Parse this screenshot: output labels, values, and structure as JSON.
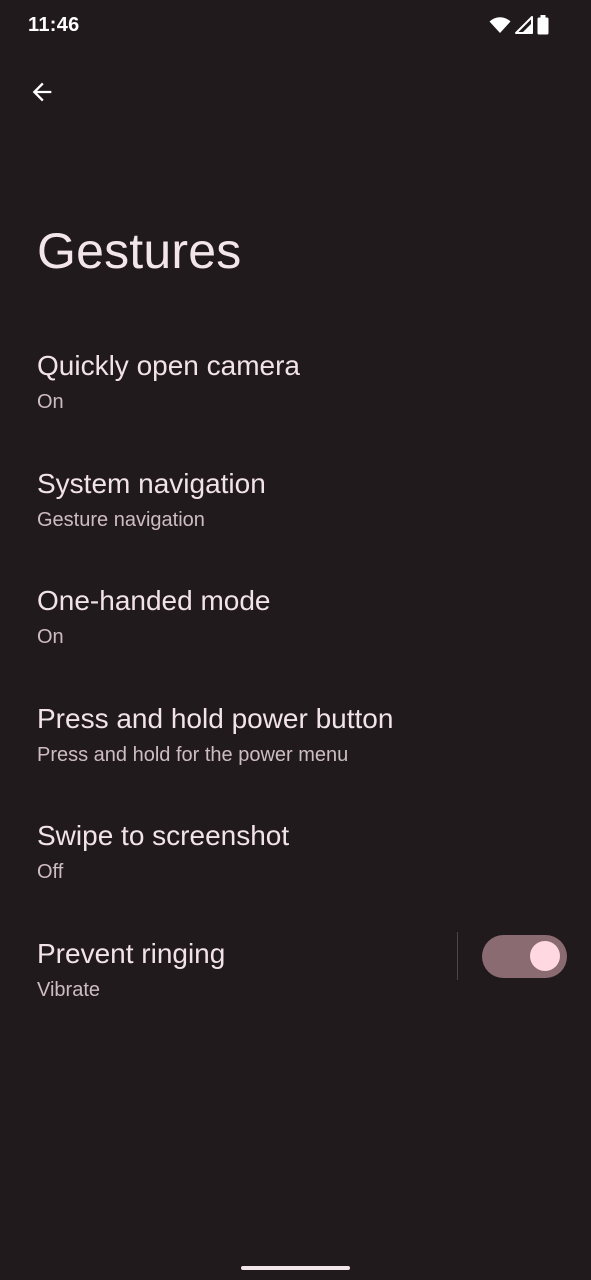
{
  "status_bar": {
    "time": "11:46",
    "icons": [
      "wifi-icon",
      "cellular-signal-icon",
      "battery-icon"
    ]
  },
  "header": {
    "back_icon": "arrow-back-icon",
    "title": "Gestures"
  },
  "settings": [
    {
      "title": "Quickly open camera",
      "summary": "On"
    },
    {
      "title": "System navigation",
      "summary": "Gesture navigation"
    },
    {
      "title": "One-handed mode",
      "summary": "On"
    },
    {
      "title": "Press and hold power button",
      "summary": "Press and hold for the power menu"
    },
    {
      "title": "Swipe to screenshot",
      "summary": "Off"
    },
    {
      "title": "Prevent ringing",
      "summary": "Vibrate",
      "toggle_on": true
    }
  ],
  "colors": {
    "background": "#211a1d",
    "toggle_track": "#8b6b72",
    "toggle_knob": "#ffd8e2"
  }
}
